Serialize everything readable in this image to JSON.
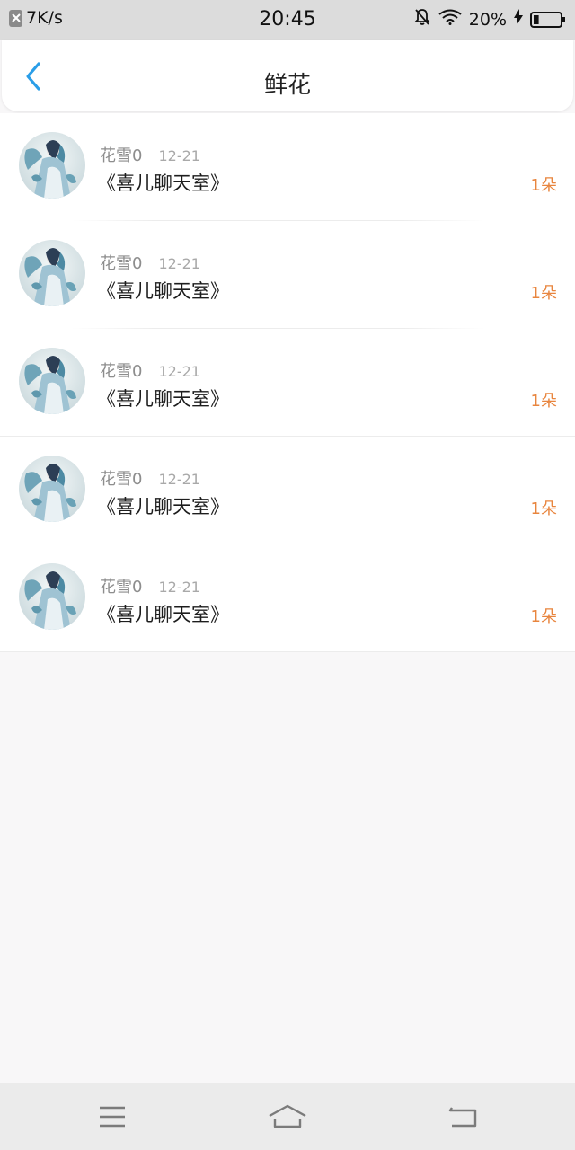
{
  "status_bar": {
    "network_speed": "7K/s",
    "time": "20:45",
    "battery_percent": "20%",
    "battery_level": 0.2,
    "icons": [
      "close-notification-icon",
      "mute-bell-icon",
      "wifi-icon",
      "charging-bolt-icon",
      "battery-icon"
    ]
  },
  "header": {
    "title": "鲜花",
    "back_icon": "chevron-left-icon",
    "accent_color": "#2a9ee8"
  },
  "flowers": [
    {
      "user": "花雪0",
      "date": "12-21",
      "room": "《喜儿聊天室》",
      "count": "1朵"
    },
    {
      "user": "花雪0",
      "date": "12-21",
      "room": "《喜儿聊天室》",
      "count": "1朵"
    },
    {
      "user": "花雪0",
      "date": "12-21",
      "room": "《喜儿聊天室》",
      "count": "1朵"
    },
    {
      "user": "花雪0",
      "date": "12-21",
      "room": "《喜儿聊天室》",
      "count": "1朵"
    },
    {
      "user": "花雪0",
      "date": "12-21",
      "room": "《喜儿聊天室》",
      "count": "1朵"
    }
  ],
  "colors": {
    "count": "#e8853e",
    "background": "#f8f7f8"
  },
  "bottom_nav": {
    "icons": [
      "menu-icon",
      "home-icon",
      "back-icon"
    ]
  }
}
